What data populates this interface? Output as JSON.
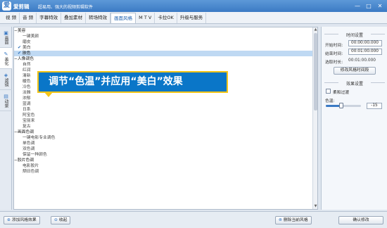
{
  "app": {
    "name": "爱剪辑",
    "slogan": "超易用、强大的视频剪辑软件",
    "logo_glyph": "爱"
  },
  "window_controls": [
    "—",
    "□",
    "✕"
  ],
  "menu_tabs": [
    {
      "label": "视 频"
    },
    {
      "label": "音 频"
    },
    {
      "label": "字幕特效"
    },
    {
      "label": "叠加素材"
    },
    {
      "label": "转场特效"
    },
    {
      "label": "画面风格",
      "active": true
    },
    {
      "label": "M T V"
    },
    {
      "label": "卡拉OK"
    },
    {
      "label": "升级与服务"
    }
  ],
  "side_tabs": [
    {
      "label": "画面",
      "icon": "picture-icon"
    },
    {
      "label": "美化",
      "icon": "beautify-icon",
      "active": true
    },
    {
      "label": "滤镜",
      "icon": "filter-icon"
    },
    {
      "label": "动景",
      "icon": "motion-icon"
    }
  ],
  "style_list": [
    {
      "type": "group",
      "label": "美容"
    },
    {
      "type": "item",
      "label": "一键美颜"
    },
    {
      "type": "item",
      "label": "磨皮"
    },
    {
      "type": "item",
      "label": "美白",
      "checked": true
    },
    {
      "type": "item",
      "label": "肤色",
      "checked": true,
      "selected": true
    },
    {
      "type": "group",
      "label": "人像调色"
    },
    {
      "type": "item",
      "label": "自然"
    },
    {
      "type": "item",
      "label": "红润"
    },
    {
      "type": "item",
      "label": "清新"
    },
    {
      "type": "item",
      "label": "暖色"
    },
    {
      "type": "item",
      "label": "冷色"
    },
    {
      "type": "item",
      "label": "淡雅"
    },
    {
      "type": "item",
      "label": "浓郁"
    },
    {
      "type": "item",
      "label": "蓝调"
    },
    {
      "type": "item",
      "label": "日系"
    },
    {
      "type": "item",
      "label": "阿宝色"
    },
    {
      "type": "item",
      "label": "宝丽来"
    },
    {
      "type": "item",
      "label": "复古"
    },
    {
      "type": "group",
      "label": "画面色调"
    },
    {
      "type": "item",
      "label": "一键电影专业调色"
    },
    {
      "type": "item",
      "label": "单色调"
    },
    {
      "type": "item",
      "label": "双色调"
    },
    {
      "type": "item",
      "label": "保留一种颜色"
    },
    {
      "type": "group",
      "label": "胶片色调"
    },
    {
      "type": "item",
      "label": "电影胶片"
    },
    {
      "type": "item",
      "label": "颓旧色调"
    }
  ],
  "callout": {
    "text": "调节“色温”并应用“美白”效果",
    "bg_color": "#0a76c8",
    "border_color": "#f5c518"
  },
  "time_settings": {
    "title": "时间设置",
    "start_label": "开始时间:",
    "start_value": "00:00:00.000",
    "end_label": "结束时间:",
    "end_value": "00:01:00.000",
    "duration_label": "选取时长:",
    "duration_value": "00:01:00.000",
    "modify_button": "修改风格时间段"
  },
  "effect_settings": {
    "title": "效果设置",
    "soft_transition_label": "柔和过渡",
    "soft_transition_checked": false,
    "color_temp_label": "色温:",
    "color_temp_value": "-15",
    "color_temp_level_percent": 43
  },
  "bottom_buttons": {
    "add_style": "添加风格效果",
    "collapse": "收起",
    "delete_style": "删除当前风格",
    "confirm": "确认修改"
  },
  "colors": {
    "accent": "#3b7ac4",
    "selected_row": "#bfd9f3",
    "titlebar": "#4a89cf"
  }
}
